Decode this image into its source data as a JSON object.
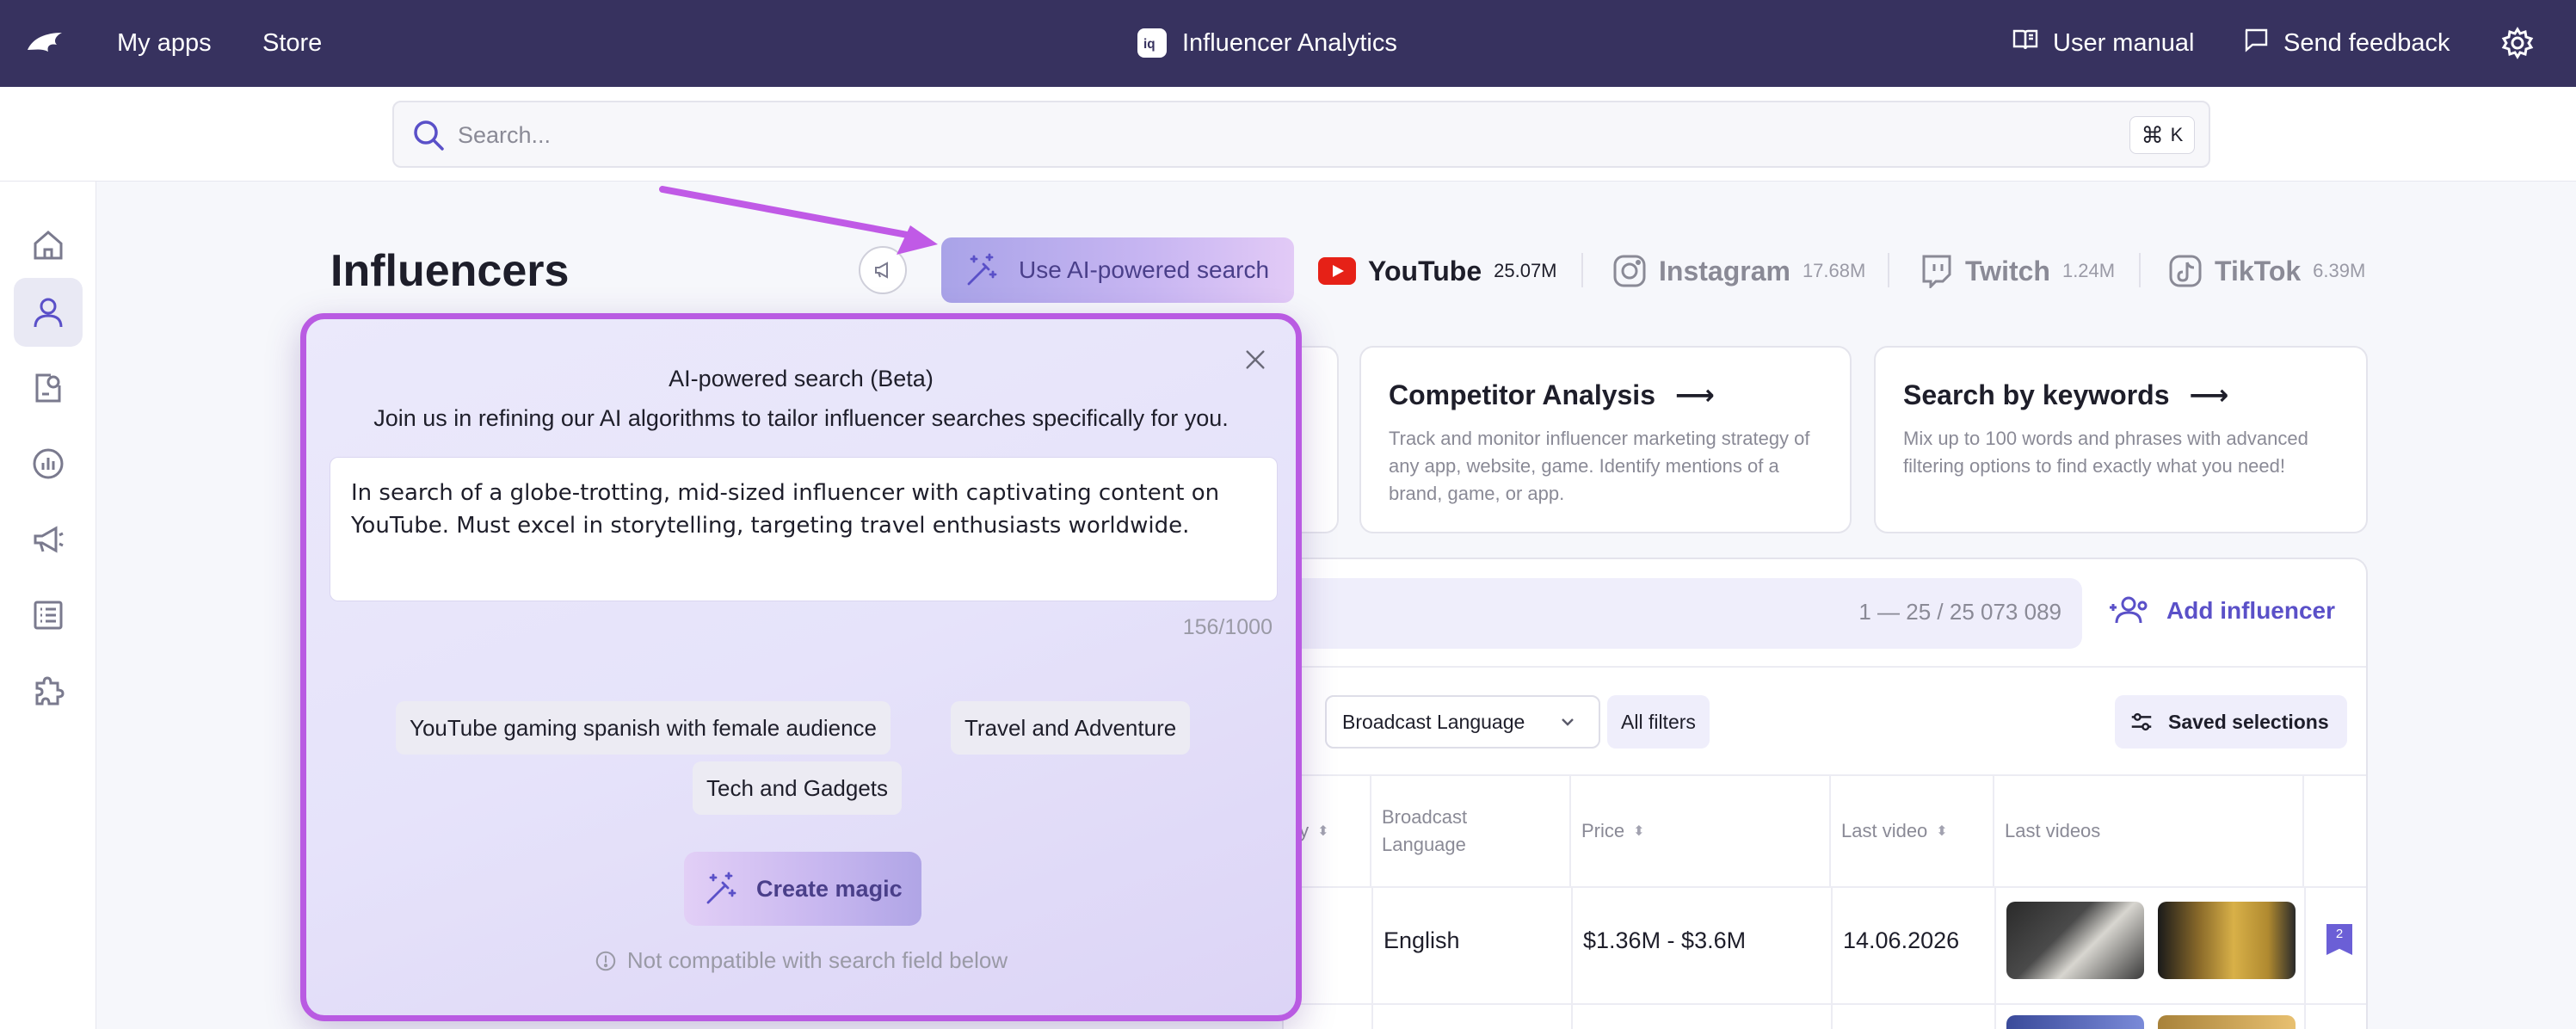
{
  "topbar": {
    "my_apps": "My apps",
    "store": "Store",
    "app_title": "Influencer Analytics",
    "user_manual": "User manual",
    "send_feedback": "Send feedback"
  },
  "search": {
    "placeholder": "Search...",
    "shortcut_symbol": "⌘",
    "shortcut_key": "K"
  },
  "sidebar": {
    "items": [
      {
        "icon": "home-icon",
        "active": false
      },
      {
        "icon": "person-icon",
        "active": true
      },
      {
        "icon": "report-icon",
        "active": false
      },
      {
        "icon": "analytics-icon",
        "active": false
      },
      {
        "icon": "megaphone-icon",
        "active": false
      },
      {
        "icon": "list-icon",
        "active": false
      },
      {
        "icon": "puzzle-icon",
        "active": false
      }
    ]
  },
  "page": {
    "title": "Influencers",
    "ai_button": "Use AI-powered search"
  },
  "platforms": [
    {
      "name": "YouTube",
      "count": "25.07M"
    },
    {
      "name": "Instagram",
      "count": "17.68M"
    },
    {
      "name": "Twitch",
      "count": "1.24M"
    },
    {
      "name": "TikTok",
      "count": "6.39M"
    }
  ],
  "cards": [
    {
      "title": "Competitor Analysis",
      "arrow": "⟶",
      "desc": "Track and monitor influencer marketing strategy of any app, website, game. Identify mentions of a brand, game, or app."
    },
    {
      "title": "Search by keywords",
      "arrow": "⟶",
      "desc": "Mix up to 100 words and phrases with advanced filtering options to find exactly what you need!"
    }
  ],
  "table": {
    "count": "1 — 25 / 25 073 089",
    "add_influencer": "Add influencer",
    "filter_broadcast": "Broadcast Language",
    "filter_all": "All filters",
    "saved_selections": "Saved selections",
    "headers": {
      "partial": "ty",
      "broadcast_language": "Broadcast Language",
      "price": "Price",
      "last_video": "Last video",
      "last_videos": "Last videos"
    },
    "rows": [
      {
        "language": "English",
        "price": "$1.36M - $3.6M",
        "last_video": "14.06.2026",
        "bookmark": "2"
      }
    ]
  },
  "ai_popup": {
    "title": "AI-powered search (Beta)",
    "subtitle": "Join us in refining our AI algorithms to tailor influencer searches specifically for you.",
    "prompt": "In search of a globe-trotting, mid-sized influencer with captivating content on YouTube. Must excel in storytelling, targeting travel enthusiasts worldwide.",
    "char_count": "156/1000",
    "suggestions": [
      "YouTube gaming spanish with female audience",
      "Travel and Adventure",
      "Tech and Gadgets"
    ],
    "create_button": "Create magic",
    "note": "Not compatible with search field below"
  },
  "colors": {
    "topbar": "#37325f",
    "accent": "#5a50c8",
    "popup_border": "#b95be2",
    "annotation_arrow": "#c05ae6",
    "youtube_red": "#e62117"
  }
}
